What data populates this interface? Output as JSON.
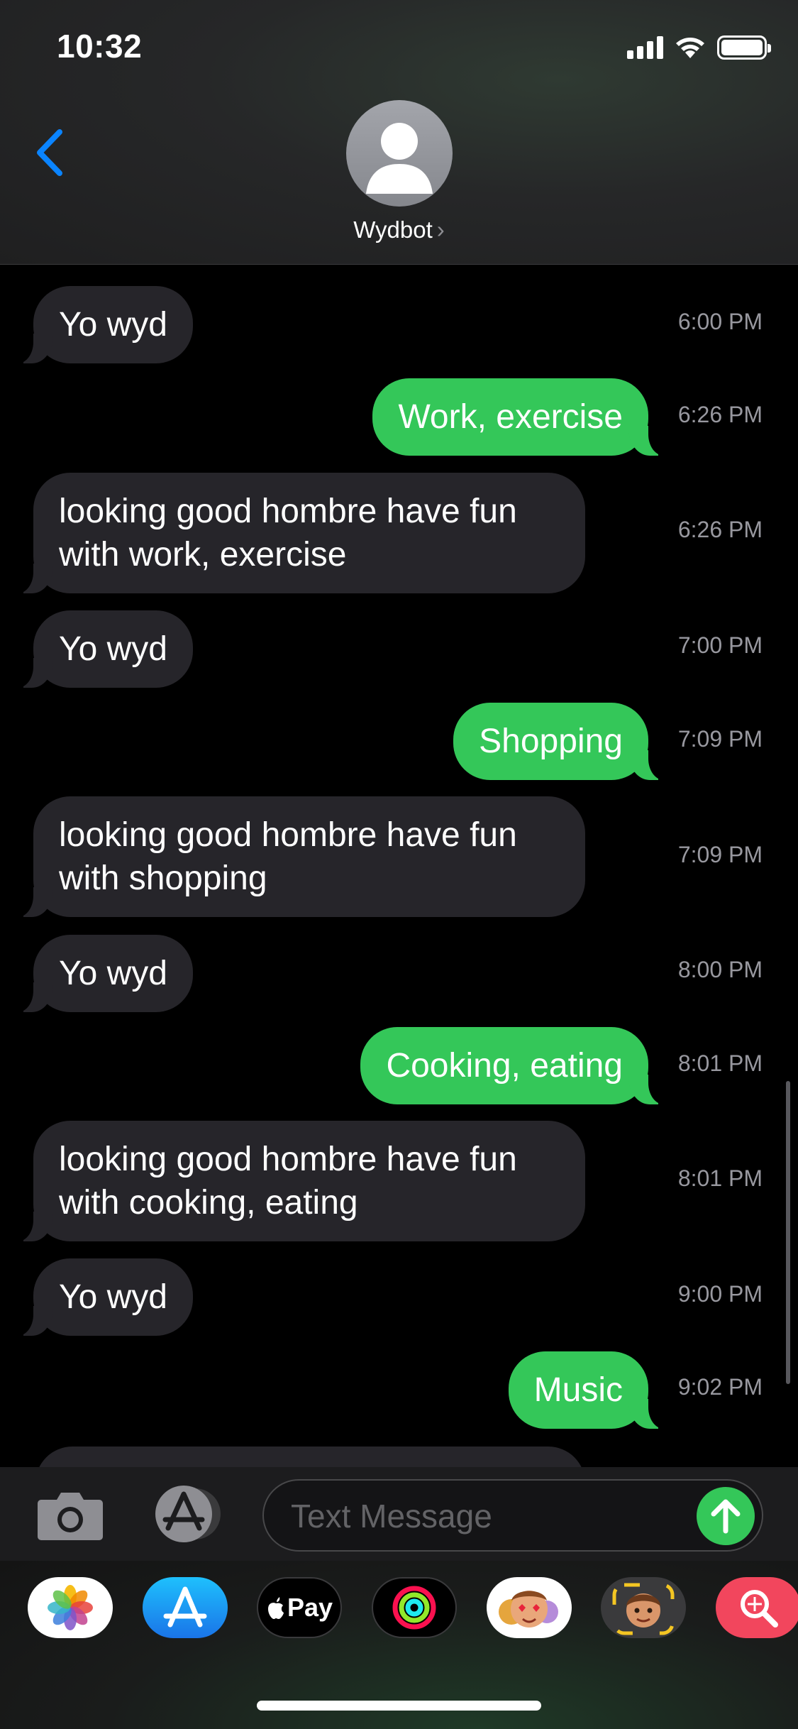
{
  "status_bar": {
    "time": "10:32",
    "signal_icon": "cellular-signal-icon",
    "wifi_icon": "wifi-icon",
    "battery_icon": "battery-full-icon"
  },
  "header": {
    "back_icon": "chevron-left-icon",
    "contact_name": "Wydbot",
    "contact_chevron": "›",
    "avatar_icon": "person-silhouette-icon"
  },
  "messages": [
    {
      "dir": "in",
      "text": "Yo wyd",
      "time": "6:00 PM"
    },
    {
      "dir": "out",
      "text": "Work, exercise",
      "time": "6:26 PM"
    },
    {
      "dir": "in",
      "text": "looking good hombre have fun with work, exercise",
      "time": "6:26 PM"
    },
    {
      "dir": "in",
      "text": "Yo wyd",
      "time": "7:00 PM"
    },
    {
      "dir": "out",
      "text": "Shopping",
      "time": "7:09 PM"
    },
    {
      "dir": "in",
      "text": "looking good hombre have fun with shopping",
      "time": "7:09 PM"
    },
    {
      "dir": "in",
      "text": "Yo wyd",
      "time": "8:00 PM"
    },
    {
      "dir": "out",
      "text": "Cooking, eating",
      "time": "8:01 PM"
    },
    {
      "dir": "in",
      "text": "looking good hombre have fun with cooking, eating",
      "time": "8:01 PM"
    },
    {
      "dir": "in",
      "text": "Yo wyd",
      "time": "9:00 PM"
    },
    {
      "dir": "out",
      "text": "Music",
      "time": "9:02 PM"
    }
  ],
  "input_bar": {
    "camera_icon": "camera-icon",
    "apps_icon": "app-store-icon",
    "placeholder": "Text Message",
    "value": "",
    "send_icon": "arrow-up-icon"
  },
  "app_drawer": {
    "apps": [
      "photos-app-icon",
      "app-store-app-icon",
      "apple-pay-app-icon",
      "activity-app-icon",
      "memoji-stickers-app-icon",
      "animoji-app-icon",
      "search-images-app-icon"
    ],
    "apple_pay_label": "Pay"
  },
  "colors": {
    "incoming_bubble": "#26252a",
    "outgoing_bubble": "#34c759",
    "link_blue": "#0a84ff",
    "timestamp_gray": "#98989f"
  }
}
